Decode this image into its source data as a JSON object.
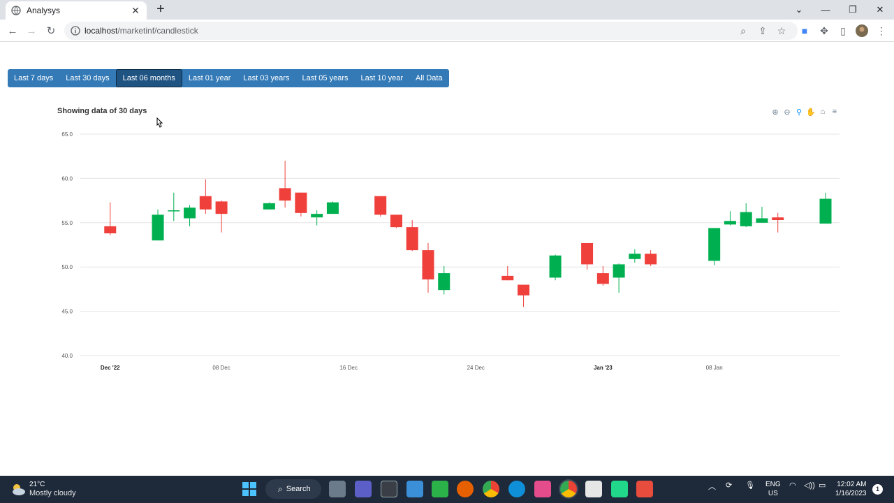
{
  "browser": {
    "tab_title": "Analysys",
    "new_tab_symbol": "+",
    "url_host": "localhost",
    "url_path": "/marketinf/candlestick"
  },
  "page": {
    "range_buttons": [
      {
        "label": "Last 7 days"
      },
      {
        "label": "Last 30 days"
      },
      {
        "label": "Last 06 months",
        "active": true
      },
      {
        "label": "Last 01 year"
      },
      {
        "label": "Last 03 years"
      },
      {
        "label": "Last 05 years"
      },
      {
        "label": "Last 10 year"
      },
      {
        "label": "All Data"
      }
    ],
    "chart_title": "Showing data of 30 days"
  },
  "chart_data": {
    "type": "candlestick",
    "title": "Showing data of 30 days",
    "ylim": [
      40,
      65
    ],
    "y_ticks": [
      "40.0",
      "45.0",
      "50.0",
      "55.0",
      "60.0",
      "65.0"
    ],
    "x_tick_labels": [
      {
        "date": "2022-12-01",
        "label": "Dec '22",
        "bold": true
      },
      {
        "date": "2022-12-08",
        "label": "08 Dec"
      },
      {
        "date": "2022-12-16",
        "label": "16 Dec"
      },
      {
        "date": "2022-12-24",
        "label": "24 Dec"
      },
      {
        "date": "2023-01-01",
        "label": "Jan '23",
        "bold": true
      },
      {
        "date": "2023-01-08",
        "label": "08 Jan"
      }
    ],
    "x_range": [
      "2022-11-30",
      "2023-01-15"
    ],
    "colors": {
      "up": "#00b050",
      "down": "#ef403c"
    },
    "grid": true,
    "candles": [
      {
        "date": "2022-12-01",
        "open": 54.6,
        "high": 57.3,
        "low": 53.6,
        "close": 53.8
      },
      {
        "date": "2022-12-04",
        "open": 53.0,
        "high": 56.5,
        "low": 53.0,
        "close": 55.9
      },
      {
        "date": "2022-12-05",
        "open": 56.3,
        "high": 58.4,
        "low": 55.2,
        "close": 56.4
      },
      {
        "date": "2022-12-06",
        "open": 55.5,
        "high": 57.0,
        "low": 54.6,
        "close": 56.7
      },
      {
        "date": "2022-12-07",
        "open": 58.0,
        "high": 59.9,
        "low": 56.0,
        "close": 56.5
      },
      {
        "date": "2022-12-08",
        "open": 57.4,
        "high": 57.5,
        "low": 53.9,
        "close": 56.0
      },
      {
        "date": "2022-12-11",
        "open": 56.5,
        "high": 57.3,
        "low": 56.5,
        "close": 57.2
      },
      {
        "date": "2022-12-12",
        "open": 58.9,
        "high": 62.0,
        "low": 56.7,
        "close": 57.5
      },
      {
        "date": "2022-12-13",
        "open": 58.4,
        "high": 58.4,
        "low": 55.7,
        "close": 56.1
      },
      {
        "date": "2022-12-14",
        "open": 55.6,
        "high": 56.4,
        "low": 54.7,
        "close": 56.0
      },
      {
        "date": "2022-12-15",
        "open": 56.0,
        "high": 57.4,
        "low": 56.0,
        "close": 57.3
      },
      {
        "date": "2022-12-18",
        "open": 58.0,
        "high": 58.0,
        "low": 55.7,
        "close": 55.9
      },
      {
        "date": "2022-12-19",
        "open": 55.9,
        "high": 55.9,
        "low": 54.4,
        "close": 54.5
      },
      {
        "date": "2022-12-20",
        "open": 54.5,
        "high": 55.3,
        "low": 51.8,
        "close": 51.9
      },
      {
        "date": "2022-12-21",
        "open": 51.9,
        "high": 52.7,
        "low": 47.1,
        "close": 48.6
      },
      {
        "date": "2022-12-22",
        "open": 47.4,
        "high": 50.1,
        "low": 46.9,
        "close": 49.3
      },
      {
        "date": "2022-12-26",
        "open": 49.0,
        "high": 50.1,
        "low": 48.5,
        "close": 48.5
      },
      {
        "date": "2022-12-27",
        "open": 48.0,
        "high": 48.0,
        "low": 45.5,
        "close": 46.8
      },
      {
        "date": "2022-12-29",
        "open": 48.8,
        "high": 51.4,
        "low": 48.5,
        "close": 51.3
      },
      {
        "date": "2022-12-31",
        "open": 52.7,
        "high": 52.7,
        "low": 49.7,
        "close": 50.3
      },
      {
        "date": "2023-01-01",
        "open": 49.3,
        "high": 50.1,
        "low": 47.9,
        "close": 48.1
      },
      {
        "date": "2023-01-02",
        "open": 48.8,
        "high": 50.4,
        "low": 47.1,
        "close": 50.3
      },
      {
        "date": "2023-01-03",
        "open": 50.9,
        "high": 52.0,
        "low": 50.5,
        "close": 51.5
      },
      {
        "date": "2023-01-04",
        "open": 51.5,
        "high": 51.9,
        "low": 50.1,
        "close": 50.3
      },
      {
        "date": "2023-01-08",
        "open": 50.7,
        "high": 54.4,
        "low": 50.2,
        "close": 54.4
      },
      {
        "date": "2023-01-09",
        "open": 54.8,
        "high": 56.3,
        "low": 54.7,
        "close": 55.2
      },
      {
        "date": "2023-01-10",
        "open": 54.6,
        "high": 57.2,
        "low": 54.5,
        "close": 56.2
      },
      {
        "date": "2023-01-11",
        "open": 55.0,
        "high": 56.8,
        "low": 55.0,
        "close": 55.5
      },
      {
        "date": "2023-01-12",
        "open": 55.6,
        "high": 56.1,
        "low": 53.9,
        "close": 55.3
      },
      {
        "date": "2023-01-15",
        "open": 54.9,
        "high": 58.4,
        "low": 54.9,
        "close": 57.7
      }
    ]
  },
  "taskbar": {
    "temperature": "21°C",
    "weather": "Mostly cloudy",
    "search_label": "Search",
    "lang_top": "ENG",
    "lang_bottom": "US",
    "time": "12:02 AM",
    "date": "1/16/2023",
    "notification_count": "1"
  }
}
